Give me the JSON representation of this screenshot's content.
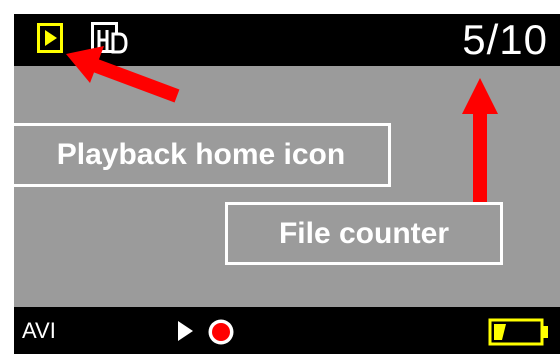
{
  "status_bar": {
    "mode_icon": "playback-icon",
    "resolution_icon": "hd-icon",
    "file_counter": "5/10"
  },
  "annotations": {
    "home_icon_label": "Playback home icon",
    "counter_label": "File counter"
  },
  "bottom_bar": {
    "format": "AVI",
    "play_icon": "play-icon",
    "record_icon": "record-icon",
    "battery_icon": "battery-icon"
  },
  "colors": {
    "icon_yellow": "#ffff00",
    "arrow_red": "#ff0000",
    "screen_gray": "#9b9b9b",
    "bar_black": "#000000"
  }
}
